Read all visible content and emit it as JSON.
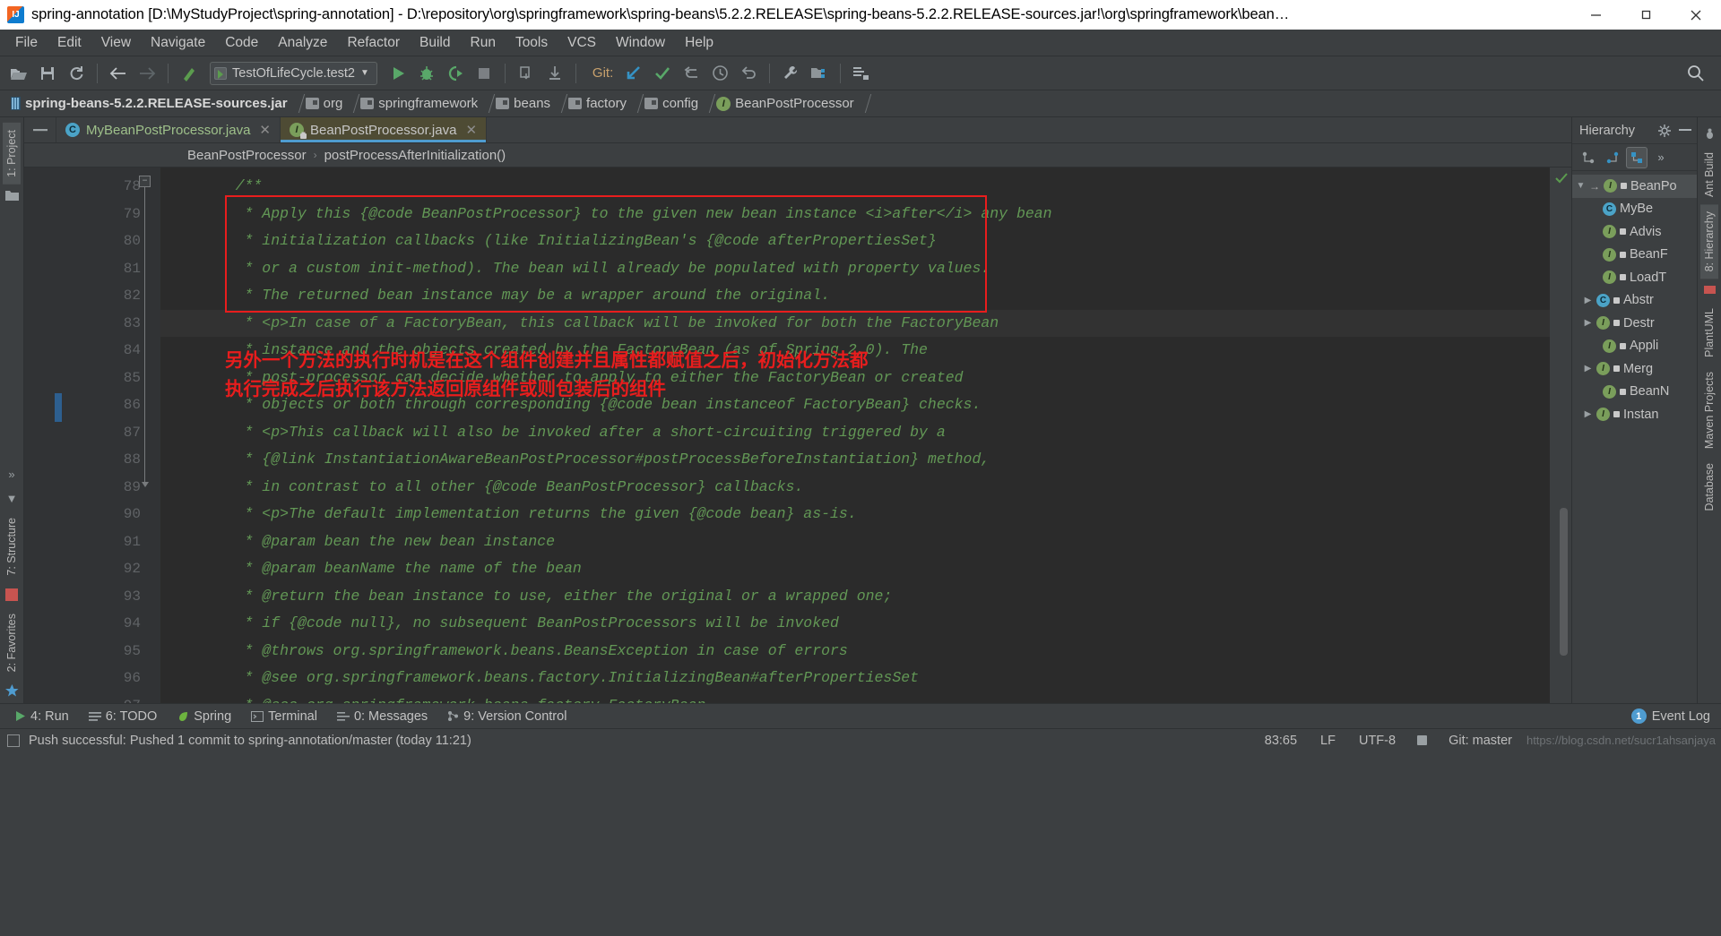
{
  "window": {
    "title": "spring-annotation [D:\\MyStudyProject\\spring-annotation] - D:\\repository\\org\\springframework\\spring-beans\\5.2.2.RELEASE\\spring-beans-5.2.2.RELEASE-sources.jar!\\org\\springframework\\bean…",
    "minimize": "—",
    "maximize": "❐",
    "close": "✕"
  },
  "menu": {
    "items": [
      "File",
      "Edit",
      "View",
      "Navigate",
      "Code",
      "Analyze",
      "Refactor",
      "Build",
      "Run",
      "Tools",
      "VCS",
      "Window",
      "Help"
    ]
  },
  "toolbar": {
    "open_icon": "open-folder-icon",
    "save_icon": "save-icon",
    "sync_icon": "sync-icon",
    "back_icon": "back-arrow-icon",
    "forward_icon": "forward-arrow-icon",
    "build_icon": "build-hammer-icon",
    "run_config": "TestOfLifeCycle.test2",
    "run_icon": "run-icon",
    "debug_icon": "debug-icon",
    "coverage_icon": "run-with-coverage-icon",
    "stop_icon": "stop-icon",
    "git_label": "Git:",
    "update_icon": "git-update-icon",
    "commit_icon": "git-commit-icon",
    "push_icon": "git-push-icon",
    "history_icon": "git-history-icon",
    "rollback_icon": "git-rollback-icon",
    "settings_icon": "settings-wrench-icon",
    "project_structure_icon": "project-structure-icon",
    "search_everywhere_icon": "search-icon"
  },
  "navbar": {
    "crumbs": [
      {
        "label": "spring-beans-5.2.2.RELEASE-sources.jar",
        "icon": "jar-icon"
      },
      {
        "label": "org",
        "icon": "folder-icon"
      },
      {
        "label": "springframework",
        "icon": "folder-icon"
      },
      {
        "label": "beans",
        "icon": "folder-icon"
      },
      {
        "label": "factory",
        "icon": "folder-icon"
      },
      {
        "label": "config",
        "icon": "folder-icon"
      },
      {
        "label": "BeanPostProcessor",
        "icon": "interface-icon",
        "icon_letter": "I"
      }
    ]
  },
  "editor_tabs": [
    {
      "label": "MyBeanPostProcessor.java",
      "icon_letter": "C",
      "icon": "class-icon",
      "active": false,
      "close": "✕"
    },
    {
      "label": "BeanPostProcessor.java",
      "icon_letter": "I",
      "icon": "interface-locked-icon",
      "active": true,
      "close": "✕"
    }
  ],
  "method_breadcrumb": {
    "class": "BeanPostProcessor",
    "separator": "›",
    "method": "postProcessAfterInitialization()"
  },
  "code": {
    "first_line": 78,
    "lines": [
      {
        "n": 78,
        "text": "    /**",
        "highlight": false
      },
      {
        "n": 79,
        "text": "     * Apply this {@code BeanPostProcessor} to the given new bean instance <i>after</i> any bean",
        "highlight": false
      },
      {
        "n": 80,
        "text": "     * initialization callbacks (like InitializingBean's {@code afterPropertiesSet}",
        "highlight": false
      },
      {
        "n": 81,
        "text": "     * or a custom init-method). The bean will already be populated with property values.",
        "highlight": false
      },
      {
        "n": 82,
        "text": "     * The returned bean instance may be a wrapper around the original.",
        "highlight": false
      },
      {
        "n": 83,
        "text": "     * <p>In case of a FactoryBean, this callback will be invoked for both the FactoryBean",
        "highlight": true
      },
      {
        "n": 84,
        "text": "     * instance and the objects created by the FactoryBean (as of Spring 2.0). The",
        "highlight": false
      },
      {
        "n": 85,
        "text": "     * post-processor can decide whether to apply to either the FactoryBean or created",
        "highlight": false
      },
      {
        "n": 86,
        "text": "     * objects or both through corresponding {@code bean instanceof FactoryBean} checks.",
        "highlight": false
      },
      {
        "n": 87,
        "text": "     * <p>This callback will also be invoked after a short-circuiting triggered by a",
        "highlight": false
      },
      {
        "n": 88,
        "text": "     * {@link InstantiationAwareBeanPostProcessor#postProcessBeforeInstantiation} method,",
        "highlight": false
      },
      {
        "n": 89,
        "text": "     * in contrast to all other {@code BeanPostProcessor} callbacks.",
        "highlight": false
      },
      {
        "n": 90,
        "text": "     * <p>The default implementation returns the given {@code bean} as-is.",
        "highlight": false
      },
      {
        "n": 91,
        "text": "     * @param bean the new bean instance",
        "highlight": false
      },
      {
        "n": 92,
        "text": "     * @param beanName the name of the bean",
        "highlight": false
      },
      {
        "n": 93,
        "text": "     * @return the bean instance to use, either the original or a wrapped one;",
        "highlight": false
      },
      {
        "n": 94,
        "text": "     * if {@code null}, no subsequent BeanPostProcessors will be invoked",
        "highlight": false
      },
      {
        "n": 95,
        "text": "     * @throws org.springframework.beans.BeansException in case of errors",
        "highlight": false
      },
      {
        "n": 96,
        "text": "     * @see org.springframework.beans.factory.InitializingBean#afterPropertiesSet",
        "highlight": false
      },
      {
        "n": 97,
        "text": "     * @see org.springframework.beans.factory.FactoryBean",
        "highlight": false
      }
    ]
  },
  "annotation": {
    "color": "#e81d1d",
    "line1": "另外一个方法的执行时机是在这个组件创建并且属性都赋值之后，初始化方法都",
    "line2": "执行完成之后执行该方法返回原组件或则包装后的组件"
  },
  "hierarchy": {
    "title": "Hierarchy",
    "settings_icon": "gear-icon",
    "minimize_icon": "minimize-icon",
    "toolbar_icons": [
      "subtypes-hierarchy-icon",
      "supertypes-hierarchy-icon",
      "class-hierarchy-icon",
      "more-options-icon"
    ],
    "nodes": [
      {
        "label": "BeanPo",
        "indent": 0,
        "chevron": "▼",
        "icon": "interface-icon",
        "letter": "I",
        "arrow": true,
        "selected": true,
        "locked": true
      },
      {
        "label": "MyBe",
        "indent": 1,
        "chevron": "",
        "icon": "class-icon",
        "letter": "C",
        "selected": false,
        "locked": false
      },
      {
        "label": "Advis",
        "indent": 1,
        "chevron": "",
        "icon": "interface-icon",
        "letter": "I",
        "selected": false,
        "locked": true
      },
      {
        "label": "BeanF",
        "indent": 1,
        "chevron": "",
        "icon": "interface-icon",
        "letter": "I",
        "selected": false,
        "locked": true
      },
      {
        "label": "LoadT",
        "indent": 1,
        "chevron": "",
        "icon": "interface-icon",
        "letter": "I",
        "selected": false,
        "locked": true
      },
      {
        "label": "Abstr",
        "indent": 1,
        "chevron": "▶",
        "icon": "class-icon",
        "letter": "C",
        "selected": false,
        "locked": true
      },
      {
        "label": "Destr",
        "indent": 1,
        "chevron": "▶",
        "icon": "interface-icon",
        "letter": "I",
        "selected": false,
        "locked": true
      },
      {
        "label": "Appli",
        "indent": 1,
        "chevron": "",
        "icon": "interface-icon",
        "letter": "I",
        "selected": false,
        "locked": true
      },
      {
        "label": "Merg",
        "indent": 1,
        "chevron": "▶",
        "icon": "interface-icon",
        "letter": "I",
        "selected": false,
        "locked": true
      },
      {
        "label": "BeanN",
        "indent": 1,
        "chevron": "",
        "icon": "interface-icon",
        "letter": "I",
        "selected": false,
        "locked": true
      },
      {
        "label": "Instan",
        "indent": 1,
        "chevron": "▶",
        "icon": "interface-icon",
        "letter": "I",
        "selected": false,
        "locked": true
      }
    ]
  },
  "left_strip": {
    "project_tab": "1: Project",
    "structure_tab": "7: Structure",
    "favorites_tab": "2: Favorites"
  },
  "right_strip": {
    "ant_build": "Ant Build",
    "hierarchy_tab": "8: Hierarchy",
    "plantuml": "PlantUML",
    "maven_projects": "Maven Projects",
    "database": "Database"
  },
  "bottom_bar": {
    "items": [
      {
        "label": "4: Run",
        "icon": "run-icon",
        "selected": false
      },
      {
        "label": "6: TODO",
        "icon": "todo-icon",
        "selected": false
      },
      {
        "label": "Spring",
        "icon": "spring-leaf-icon",
        "selected": false
      },
      {
        "label": "Terminal",
        "icon": "terminal-icon",
        "selected": false
      },
      {
        "label": "0: Messages",
        "icon": "messages-icon",
        "selected": false
      },
      {
        "label": "9: Version Control",
        "icon": "version-control-icon",
        "selected": false
      }
    ],
    "event_log": "Event Log",
    "event_count": "1"
  },
  "status_bar": {
    "message": "Push successful: Pushed 1 commit to spring-annotation/master (today 11:21)",
    "caret": "83:65",
    "line_sep": "LF",
    "encoding": "UTF-8",
    "branch": "Git: master",
    "watermark": "https://blog.csdn.net/sucr1ahsanjaya"
  }
}
